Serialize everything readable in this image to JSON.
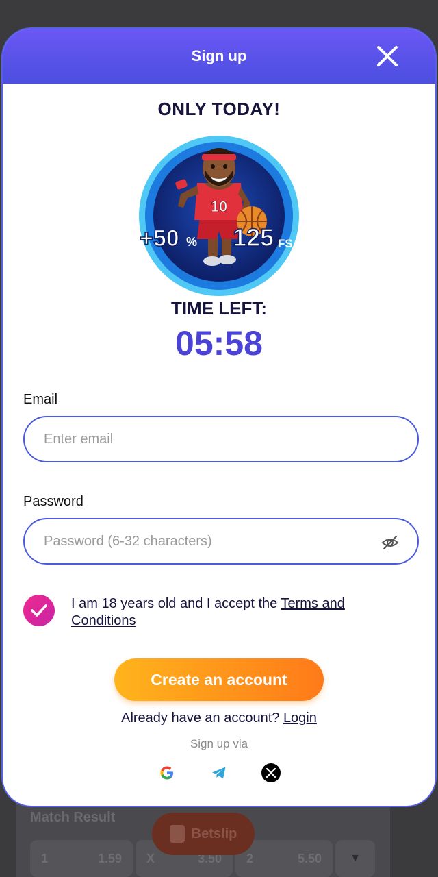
{
  "modal": {
    "title": "Sign up",
    "promo_title": "ONLY TODAY!",
    "badge": {
      "percent_text": "+50",
      "percent_sign": "%",
      "spins_text": "125",
      "spins_unit": "FS",
      "jersey_number": "10"
    },
    "timer_label": "TIME LEFT:",
    "timer_value": "05:58"
  },
  "form": {
    "email_label": "Email",
    "email_placeholder": "Enter email",
    "password_label": "Password",
    "password_placeholder": "Password (6-32 characters)",
    "consent_text": "I am 18 years old and I accept the ",
    "terms_link": "Terms and Conditions",
    "consent_checked": true,
    "create_button": "Create an account",
    "login_prompt": "Already have an account? ",
    "login_link": "Login",
    "signup_via": "Sign up via"
  },
  "social": [
    "google-icon",
    "telegram-icon",
    "x-icon"
  ],
  "background": {
    "match_title": "Match Result",
    "betslip": "Betslip",
    "odds": [
      {
        "label": "1",
        "value": "1.59"
      },
      {
        "label": "X",
        "value": "3.50"
      },
      {
        "label": "2",
        "value": "5.50"
      }
    ]
  },
  "colors": {
    "header": "#5a52ec",
    "accent": "#4a43d6",
    "button": "#ff9a1c",
    "checkbox": "#e02896"
  }
}
